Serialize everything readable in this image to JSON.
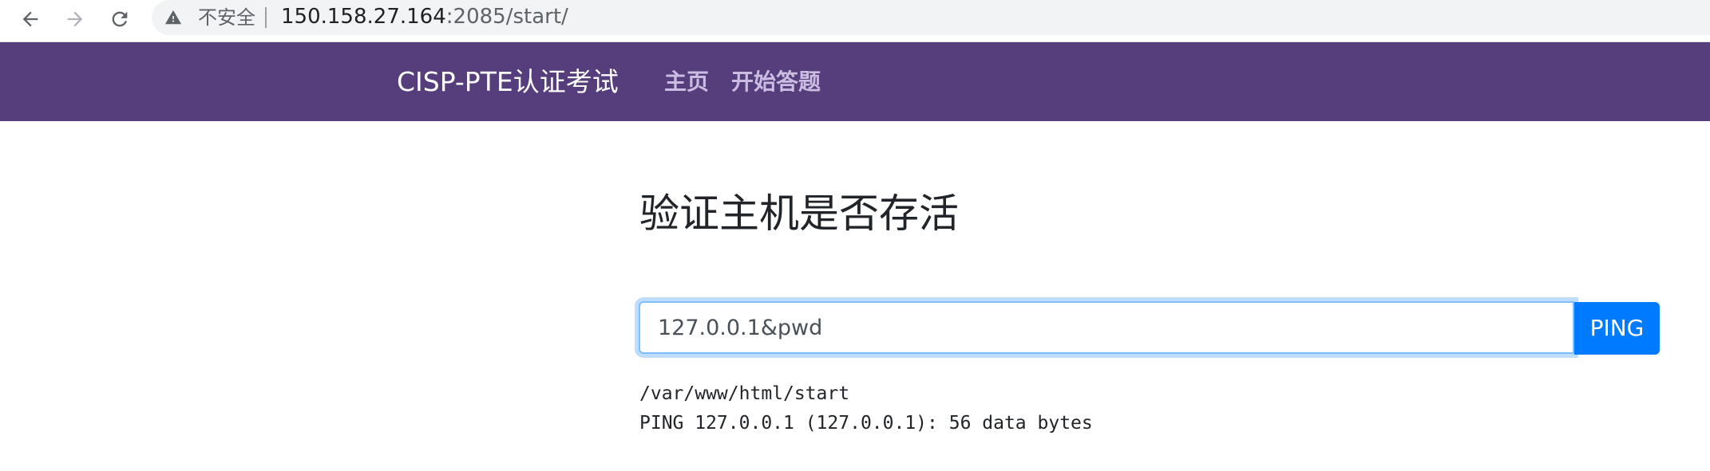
{
  "browser": {
    "security_label": "不安全",
    "url_host": "150.158.27.164",
    "url_rest": ":2085/start/"
  },
  "navbar": {
    "brand": "CISP-PTE认证考试",
    "links": [
      {
        "label": "主页"
      },
      {
        "label": "开始答题"
      }
    ],
    "background_color": "#563d7c",
    "link_color": "#cbbde2"
  },
  "main": {
    "heading": "验证主机是否存活",
    "input_value": "127.0.0.1&pwd",
    "button_label": "PING",
    "button_color": "#007bff",
    "output_lines": [
      "/var/www/html/start",
      "PING 127.0.0.1 (127.0.0.1): 56 data bytes"
    ]
  },
  "icons": {
    "back": "back-arrow-icon",
    "forward": "forward-arrow-icon",
    "reload": "reload-icon",
    "warning": "warning-triangle-icon"
  }
}
